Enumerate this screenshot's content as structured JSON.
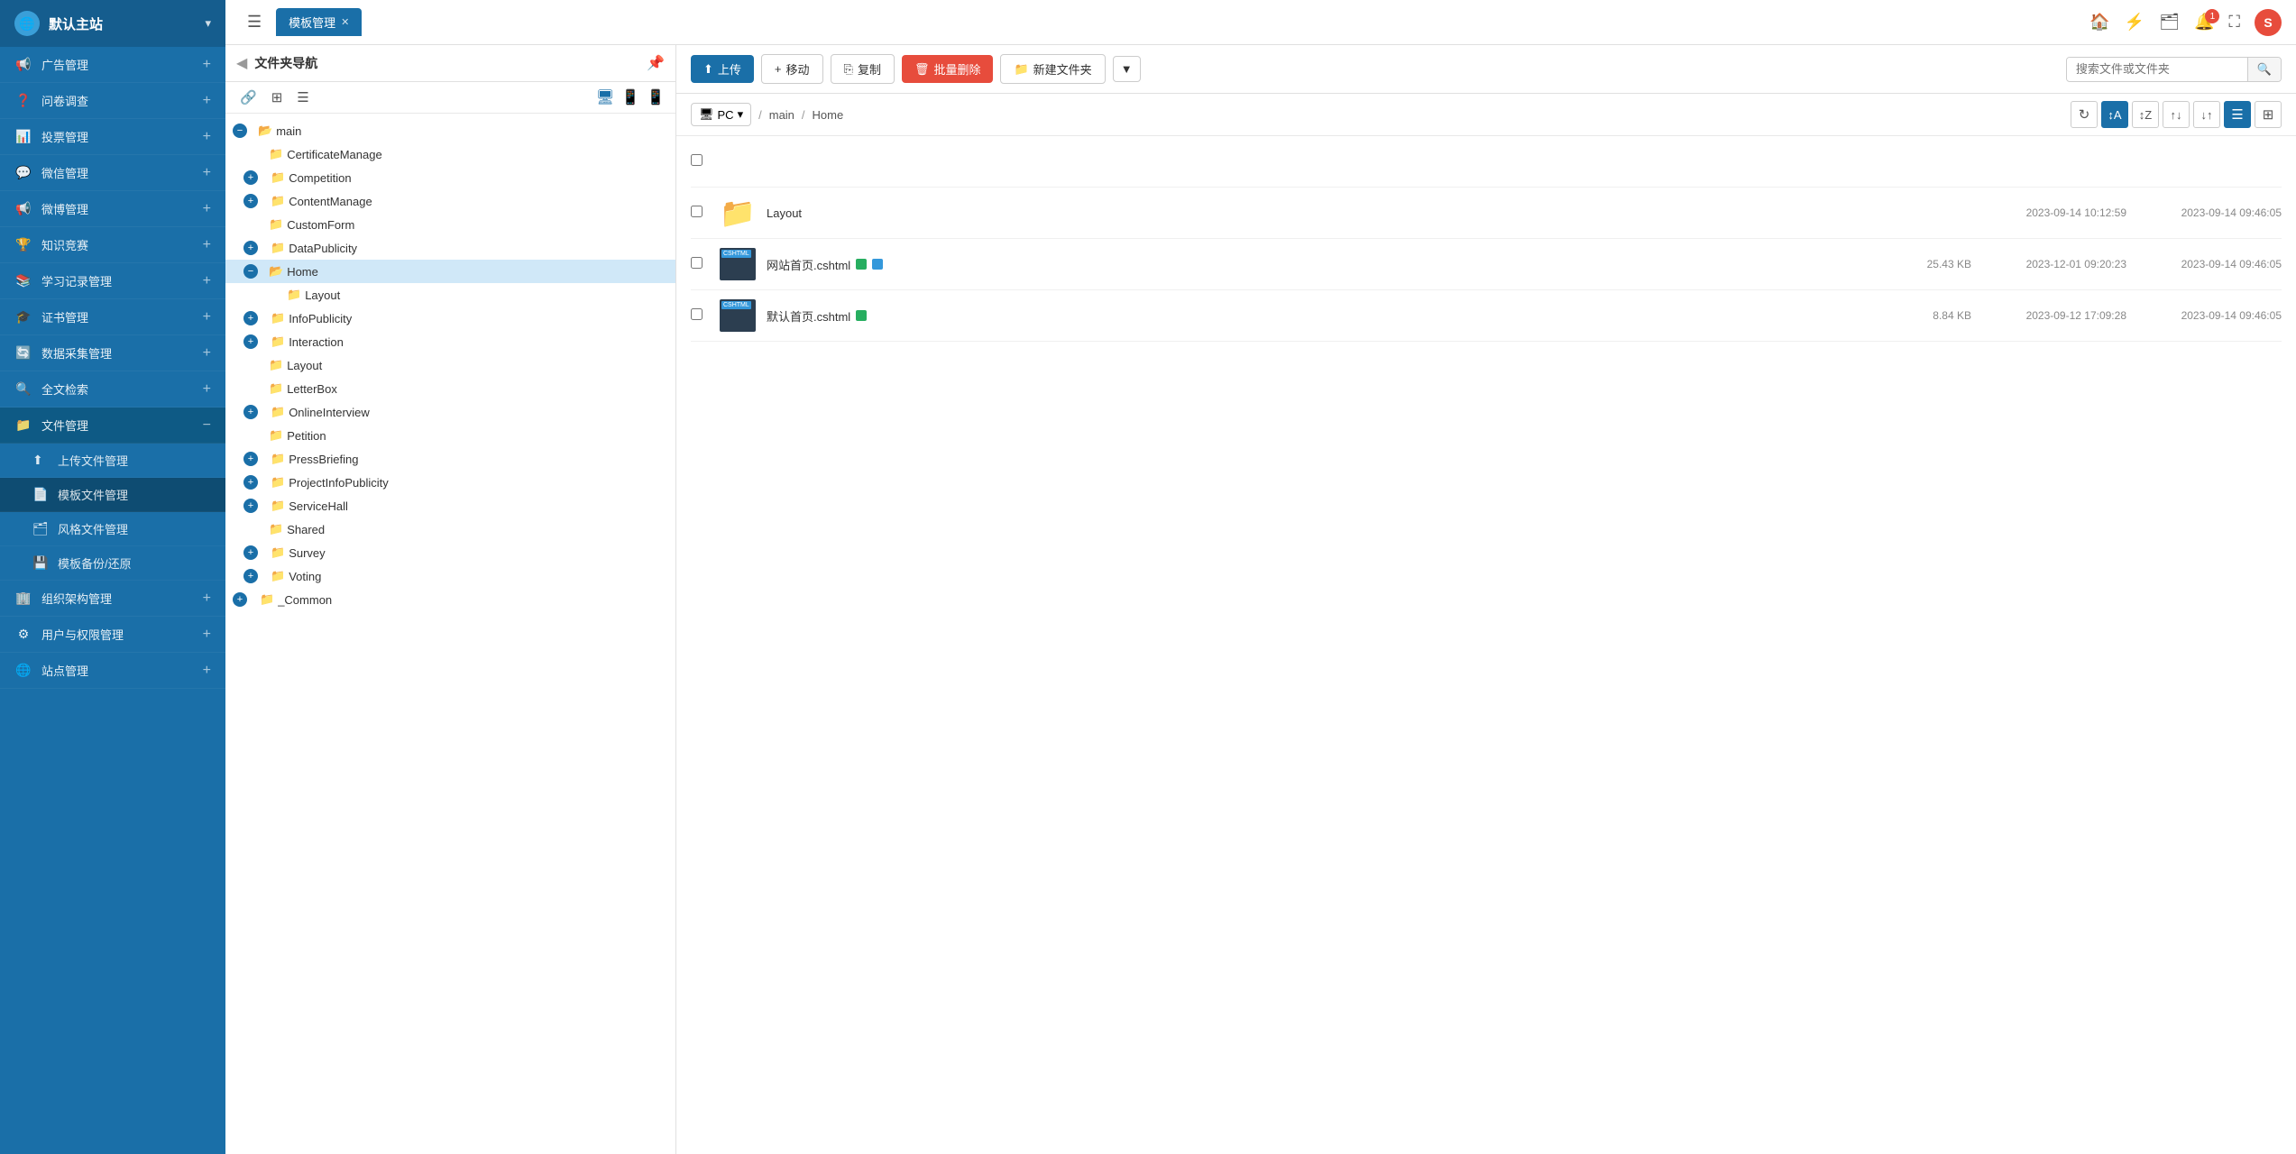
{
  "sidebar": {
    "site_name": "默认主站",
    "items": [
      {
        "id": "ad-mgmt",
        "label": "广告管理",
        "icon": "📢",
        "has_children": true
      },
      {
        "id": "survey",
        "label": "问卷调查",
        "icon": "📋",
        "has_children": true
      },
      {
        "id": "vote-mgmt",
        "label": "投票管理",
        "icon": "📊",
        "has_children": true
      },
      {
        "id": "wechat-mgmt",
        "label": "微信管理",
        "icon": "💬",
        "has_children": true
      },
      {
        "id": "weibo-mgmt",
        "label": "微博管理",
        "icon": "📢",
        "has_children": true
      },
      {
        "id": "knowledge",
        "label": "知识竞赛",
        "icon": "🏆",
        "has_children": true
      },
      {
        "id": "study-records",
        "label": "学习记录管理",
        "icon": "📚",
        "has_children": true
      },
      {
        "id": "cert-mgmt",
        "label": "证书管理",
        "icon": "🎓",
        "has_children": true
      },
      {
        "id": "data-collect",
        "label": "数据采集管理",
        "icon": "🔄",
        "has_children": true
      },
      {
        "id": "fulltext-search",
        "label": "全文检索",
        "icon": "🔍",
        "has_children": true
      },
      {
        "id": "file-mgmt",
        "label": "文件管理",
        "icon": "📁",
        "has_children": true,
        "expanded": true
      },
      {
        "id": "upload-file-mgmt",
        "label": "上传文件管理",
        "icon": "⬆",
        "sub": true
      },
      {
        "id": "template-file-mgmt",
        "label": "模板文件管理",
        "icon": "📄",
        "sub": true,
        "active": true
      },
      {
        "id": "style-file-mgmt",
        "label": "风格文件管理",
        "icon": "🗂",
        "sub": true
      },
      {
        "id": "template-backup",
        "label": "模板备份/还原",
        "icon": "💾",
        "sub": true
      },
      {
        "id": "org-mgmt",
        "label": "组织架构管理",
        "icon": "🏢",
        "has_children": true
      },
      {
        "id": "user-perm",
        "label": "用户与权限管理",
        "icon": "⚙",
        "has_children": true
      },
      {
        "id": "site-mgmt",
        "label": "站点管理",
        "icon": "🌐",
        "has_children": true
      }
    ]
  },
  "topbar": {
    "menu_icon": "☰",
    "tab_active_label": "模板管理",
    "tab_inactive_label": "",
    "close_icon": "✕",
    "icons": {
      "home": "🏠",
      "lightning": "⚡",
      "folder": "🗂",
      "bell": "🔔",
      "expand": "⛶",
      "avatar": "S"
    },
    "notification_count": "1"
  },
  "file_nav": {
    "title": "文件夹导航",
    "pin_icon": "📌",
    "collapse_icon": "◀",
    "tree": {
      "root": "main",
      "items": [
        {
          "id": "main",
          "label": "main",
          "level": 0,
          "expanded": true,
          "icon": "folder-open"
        },
        {
          "id": "cert-manage",
          "label": "CertificateManage",
          "level": 1,
          "icon": "folder"
        },
        {
          "id": "competition",
          "label": "Competition",
          "level": 1,
          "icon": "folder",
          "expandable": true
        },
        {
          "id": "content-manage",
          "label": "ContentManage",
          "level": 1,
          "icon": "folder",
          "expandable": true
        },
        {
          "id": "custom-form",
          "label": "CustomForm",
          "level": 1,
          "icon": "folder"
        },
        {
          "id": "data-publicity",
          "label": "DataPublicity",
          "level": 1,
          "icon": "folder",
          "expandable": true
        },
        {
          "id": "home",
          "label": "Home",
          "level": 1,
          "icon": "folder-selected",
          "selected": true,
          "expanded": true
        },
        {
          "id": "layout-sub",
          "label": "Layout",
          "level": 2,
          "icon": "folder"
        },
        {
          "id": "info-publicity",
          "label": "InfoPublicity",
          "level": 1,
          "icon": "folder",
          "expandable": true
        },
        {
          "id": "interaction",
          "label": "Interaction",
          "level": 1,
          "icon": "folder",
          "expandable": true
        },
        {
          "id": "layout",
          "label": "Layout",
          "level": 1,
          "icon": "folder"
        },
        {
          "id": "letter-box",
          "label": "LetterBox",
          "level": 1,
          "icon": "folder"
        },
        {
          "id": "online-interview",
          "label": "OnlineInterview",
          "level": 1,
          "icon": "folder",
          "expandable": true
        },
        {
          "id": "petition",
          "label": "Petition",
          "level": 1,
          "icon": "folder"
        },
        {
          "id": "press-briefing",
          "label": "PressBriefing",
          "level": 1,
          "icon": "folder",
          "expandable": true
        },
        {
          "id": "project-info",
          "label": "ProjectInfoPublicity",
          "level": 1,
          "icon": "folder",
          "expandable": true
        },
        {
          "id": "service-hall",
          "label": "ServiceHall",
          "level": 1,
          "icon": "folder",
          "expandable": true
        },
        {
          "id": "shared",
          "label": "Shared",
          "level": 1,
          "icon": "folder"
        },
        {
          "id": "survey-tree",
          "label": "Survey",
          "level": 1,
          "icon": "folder",
          "expandable": true
        },
        {
          "id": "voting",
          "label": "Voting",
          "level": 1,
          "icon": "folder",
          "expandable": true
        },
        {
          "id": "common",
          "label": "_Common",
          "level": 0,
          "icon": "folder",
          "expandable": true
        }
      ]
    }
  },
  "file_panel": {
    "toolbar": {
      "upload": "上传",
      "move": "移动",
      "copy": "复制",
      "batch_delete": "批量删除",
      "new_folder": "新建文件夹",
      "more": "▼",
      "search_placeholder": "搜索文件或文件夹"
    },
    "breadcrumb": {
      "device": "PC",
      "path": [
        "main",
        "Home"
      ]
    },
    "files": [
      {
        "id": "layout-folder",
        "name": "Layout",
        "type": "folder",
        "size": "",
        "date1": "2023-09-14 10:12:59",
        "date2": "2023-09-14 09:46:05"
      },
      {
        "id": "website-home",
        "name": "网站首页.cshtml",
        "type": "cshtml",
        "size": "25.43 KB",
        "date1": "2023-12-01 09:20:23",
        "date2": "2023-09-14 09:46:05",
        "tags": [
          "green",
          "blue"
        ]
      },
      {
        "id": "default-home",
        "name": "默认首页.cshtml",
        "type": "cshtml",
        "size": "8.84 KB",
        "date1": "2023-09-12 17:09:28",
        "date2": "2023-09-14 09:46:05",
        "tags": [
          "green"
        ]
      }
    ]
  }
}
